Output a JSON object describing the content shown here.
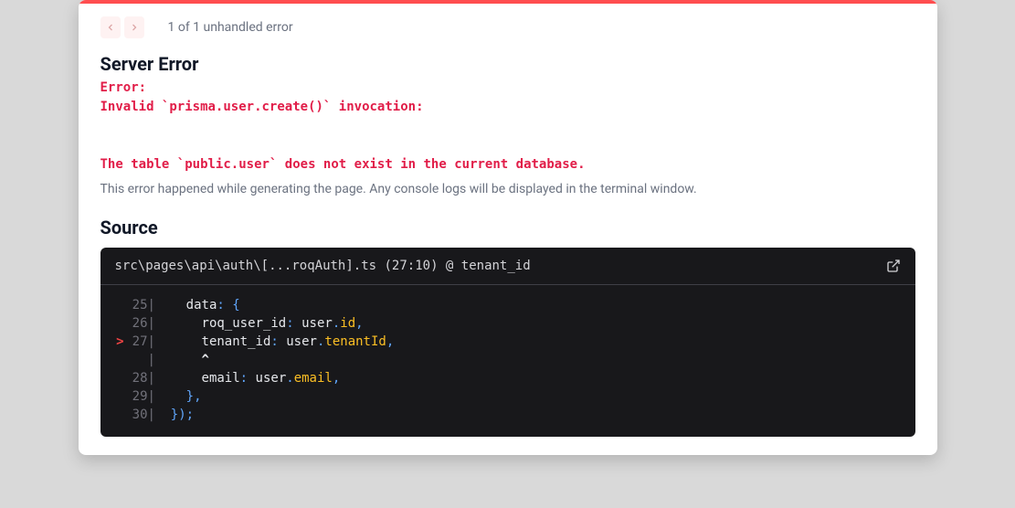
{
  "nav": {
    "error_count_text": "1 of 1 unhandled error"
  },
  "headings": {
    "server_error": "Server Error",
    "source": "Source"
  },
  "error": {
    "message": "Error: \nInvalid `prisma.user.create()` invocation:\n\n\nThe table `public.user` does not exist in the current database.",
    "hint": "This error happened while generating the page. Any console logs will be displayed in the terminal window."
  },
  "source": {
    "location": "src\\pages\\api\\auth\\[...roqAuth].ts (27:10) @ tenant_id",
    "lines": {
      "l25_no": "25",
      "l25_indent": "    ",
      "l25_key": "data",
      "l26_no": "26",
      "l26_indent": "      ",
      "l26_key": "roq_user_id",
      "l26_obj": "user",
      "l26_prop": "id",
      "l27_no": "27",
      "l27_indent": "      ",
      "l27_key": "tenant_id",
      "l27_obj": "user",
      "l27_prop": "tenantId",
      "cursor_marker": ">",
      "caret_indent": "      ",
      "caret": "^",
      "l28_no": "28",
      "l28_indent": "      ",
      "l28_key": "email",
      "l28_obj": "user",
      "l28_prop": "email",
      "l29_no": "29",
      "l29_indent": "    ",
      "l29_text": "},",
      "l30_no": "30",
      "l30_indent": "  ",
      "l30_text": "});"
    }
  }
}
